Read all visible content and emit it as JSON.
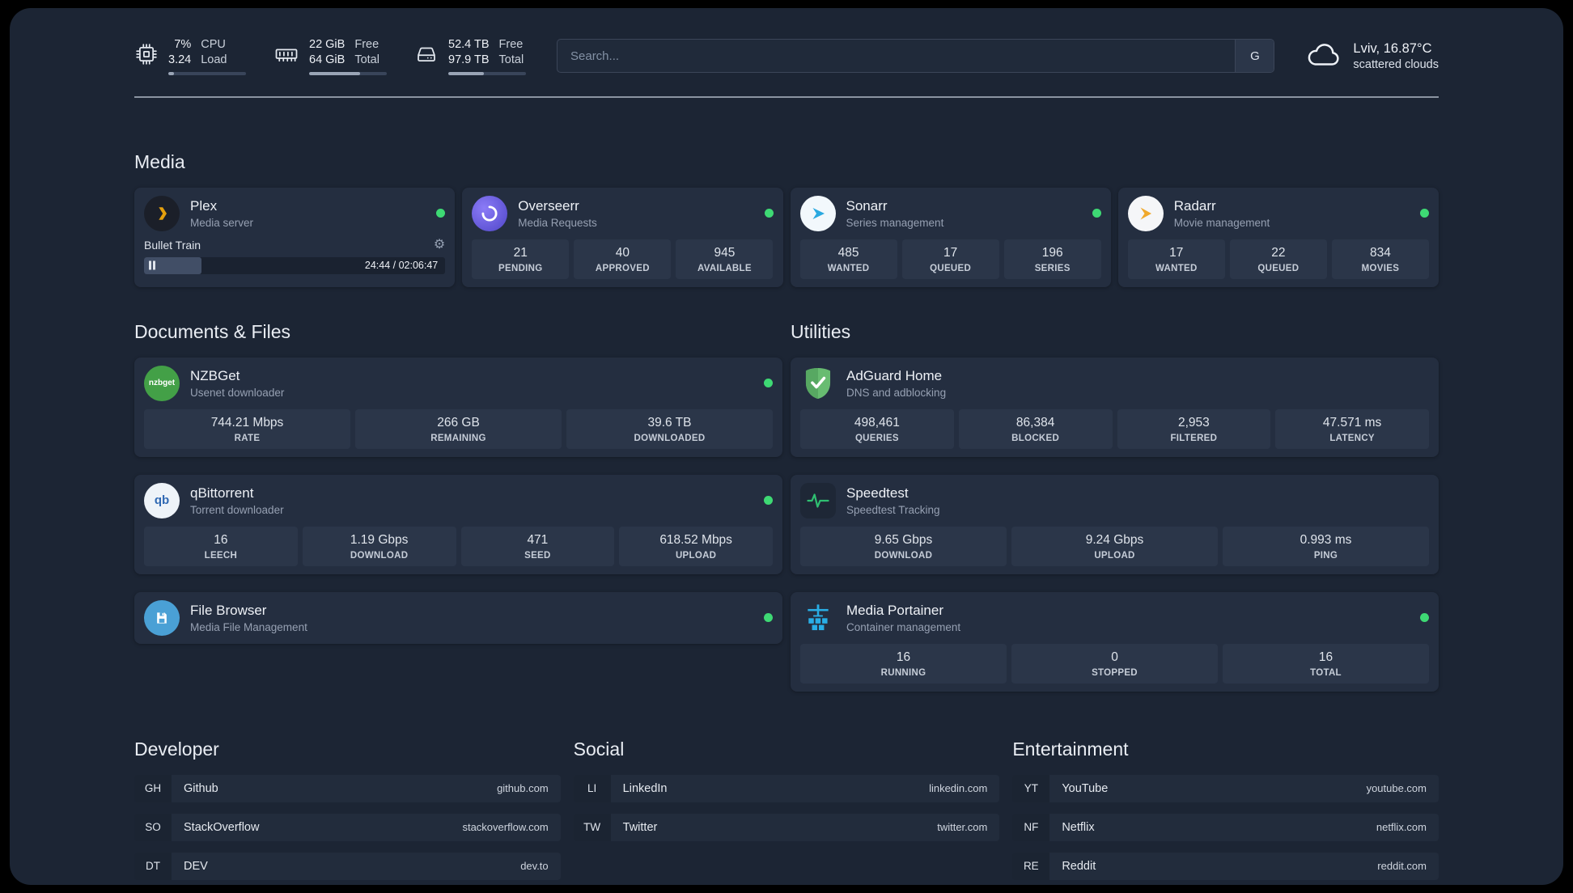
{
  "topbar": {
    "cpu": {
      "value1": "7%",
      "value2": "3.24",
      "label1": "CPU",
      "label2": "Load",
      "bar_percent": 7
    },
    "ram": {
      "value1": "22 GiB",
      "value2": "64 GiB",
      "label1": "Free",
      "label2": "Total",
      "bar_percent": 66
    },
    "disk": {
      "value1": "52.4 TB",
      "value2": "97.9 TB",
      "label1": "Free",
      "label2": "Total",
      "bar_percent": 46
    },
    "search": {
      "placeholder": "Search...",
      "engine_label": "G"
    },
    "weather": {
      "location": "Lviv, 16.87°C",
      "condition": "scattered clouds"
    }
  },
  "sections": {
    "media": {
      "title": "Media"
    },
    "documents": {
      "title": "Documents & Files"
    },
    "utilities": {
      "title": "Utilities"
    },
    "developer": {
      "title": "Developer"
    },
    "social": {
      "title": "Social"
    },
    "entertainment": {
      "title": "Entertainment"
    }
  },
  "apps": {
    "plex": {
      "name": "Plex",
      "subtitle": "Media server",
      "now_playing": "Bullet Train",
      "time": "24:44 / 02:06:47",
      "progress_percent": 19
    },
    "overseerr": {
      "name": "Overseerr",
      "subtitle": "Media Requests",
      "stats": [
        {
          "value": "21",
          "label": "PENDING"
        },
        {
          "value": "40",
          "label": "APPROVED"
        },
        {
          "value": "945",
          "label": "AVAILABLE"
        }
      ]
    },
    "sonarr": {
      "name": "Sonarr",
      "subtitle": "Series management",
      "stats": [
        {
          "value": "485",
          "label": "WANTED"
        },
        {
          "value": "17",
          "label": "QUEUED"
        },
        {
          "value": "196",
          "label": "SERIES"
        }
      ]
    },
    "radarr": {
      "name": "Radarr",
      "subtitle": "Movie management",
      "stats": [
        {
          "value": "17",
          "label": "WANTED"
        },
        {
          "value": "22",
          "label": "QUEUED"
        },
        {
          "value": "834",
          "label": "MOVIES"
        }
      ]
    },
    "nzbget": {
      "name": "NZBGet",
      "subtitle": "Usenet downloader",
      "stats": [
        {
          "value": "744.21 Mbps",
          "label": "RATE"
        },
        {
          "value": "266 GB",
          "label": "REMAINING"
        },
        {
          "value": "39.6 TB",
          "label": "DOWNLOADED"
        }
      ]
    },
    "qbittorrent": {
      "name": "qBittorrent",
      "subtitle": "Torrent downloader",
      "stats": [
        {
          "value": "16",
          "label": "LEECH"
        },
        {
          "value": "1.19 Gbps",
          "label": "DOWNLOAD"
        },
        {
          "value": "471",
          "label": "SEED"
        },
        {
          "value": "618.52 Mbps",
          "label": "UPLOAD"
        }
      ]
    },
    "filebrowser": {
      "name": "File Browser",
      "subtitle": "Media File Management"
    },
    "adguard": {
      "name": "AdGuard Home",
      "subtitle": "DNS and adblocking",
      "stats": [
        {
          "value": "498,461",
          "label": "QUERIES"
        },
        {
          "value": "86,384",
          "label": "BLOCKED"
        },
        {
          "value": "2,953",
          "label": "FILTERED"
        },
        {
          "value": "47.571 ms",
          "label": "LATENCY"
        }
      ]
    },
    "speedtest": {
      "name": "Speedtest",
      "subtitle": "Speedtest Tracking",
      "stats": [
        {
          "value": "9.65 Gbps",
          "label": "DOWNLOAD"
        },
        {
          "value": "9.24 Gbps",
          "label": "UPLOAD"
        },
        {
          "value": "0.993 ms",
          "label": "PING"
        }
      ]
    },
    "portainer": {
      "name": "Media Portainer",
      "subtitle": "Container management",
      "stats": [
        {
          "value": "16",
          "label": "RUNNING"
        },
        {
          "value": "0",
          "label": "STOPPED"
        },
        {
          "value": "16",
          "label": "TOTAL"
        }
      ]
    }
  },
  "bookmarks": {
    "developer": [
      {
        "abbr": "GH",
        "label": "Github",
        "url": "github.com"
      },
      {
        "abbr": "SO",
        "label": "StackOverflow",
        "url": "stackoverflow.com"
      },
      {
        "abbr": "DT",
        "label": "DEV",
        "url": "dev.to"
      }
    ],
    "social": [
      {
        "abbr": "LI",
        "label": "LinkedIn",
        "url": "linkedin.com"
      },
      {
        "abbr": "TW",
        "label": "Twitter",
        "url": "twitter.com"
      }
    ],
    "entertainment": [
      {
        "abbr": "YT",
        "label": "YouTube",
        "url": "youtube.com"
      },
      {
        "abbr": "NF",
        "label": "Netflix",
        "url": "netflix.com"
      },
      {
        "abbr": "RE",
        "label": "Reddit",
        "url": "reddit.com"
      }
    ]
  },
  "icons": {
    "gear": "⚙",
    "nzbget_text": "nzbget",
    "qbittorrent_text": "qb"
  },
  "colors": {
    "background": "#1c2534",
    "card": "#242e40",
    "tile": "#2b3649",
    "status_green": "#3ed974",
    "plex_gold": "#e5a00d"
  }
}
